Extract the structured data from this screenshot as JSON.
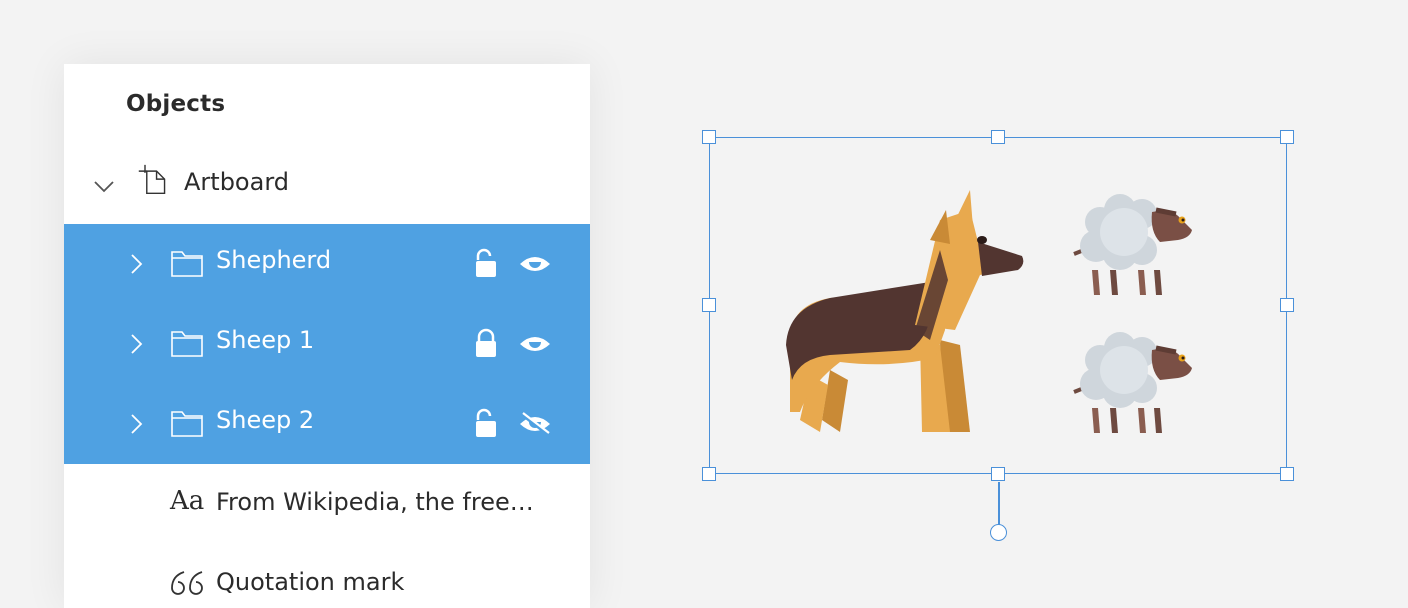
{
  "panel": {
    "title": "Objects",
    "artboard": {
      "label": "Artboard"
    },
    "layers": [
      {
        "label": "Shepherd",
        "locked": false,
        "visible": true
      },
      {
        "label": "Sheep 1",
        "locked": true,
        "visible": true
      },
      {
        "label": "Sheep 2",
        "locked": false,
        "visible": false
      }
    ],
    "text_item": {
      "icon_text": "Aa",
      "label": "From Wikipedia, the free…"
    },
    "quote_item": {
      "label": "Quotation mark"
    }
  },
  "colors": {
    "selection_bg": "#4fa1e2",
    "selection_border": "#4a90d9",
    "dog_tan": "#e8a94e",
    "dog_dark": "#523530",
    "sheep_wool": "#cfd6dc",
    "sheep_face": "#7a4f45"
  }
}
